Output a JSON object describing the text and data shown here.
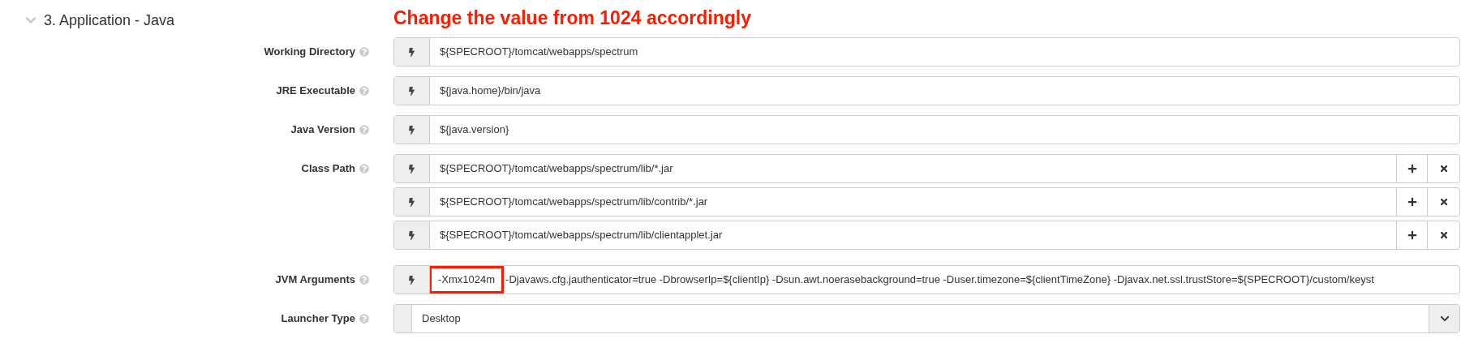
{
  "section": {
    "title": "3. Application - Java",
    "expanded": true
  },
  "annotation": "Change the value from 1024 accordingly",
  "fields": [
    {
      "kind": "text",
      "label": "Working Directory",
      "values": [
        "${SPECROOT}/tomcat/webapps/spectrum"
      ]
    },
    {
      "kind": "text",
      "label": "JRE Executable",
      "values": [
        "${java.home}/bin/java"
      ]
    },
    {
      "kind": "text",
      "label": "Java Version",
      "values": [
        "${java.version}"
      ]
    },
    {
      "kind": "list",
      "label": "Class Path",
      "values": [
        "${SPECROOT}/tomcat/webapps/spectrum/lib/*.jar",
        "${SPECROOT}/tomcat/webapps/spectrum/lib/contrib/*.jar",
        "${SPECROOT}/tomcat/webapps/spectrum/lib/clientapplet.jar"
      ]
    },
    {
      "kind": "highlighted",
      "label": "JVM Arguments",
      "highlight": "-Xmx1024m",
      "value": "-Djavaws.cfg.jauthenticator=true -DbrowserIp=${clientIp} -Dsun.awt.noerasebackground=true -Duser.timezone=${clientTimeZone} -Djavax.net.ssl.trustStore=${SPECROOT}/custom/keyst"
    },
    {
      "kind": "select",
      "label": "Launcher Type",
      "value": "Desktop"
    }
  ]
}
